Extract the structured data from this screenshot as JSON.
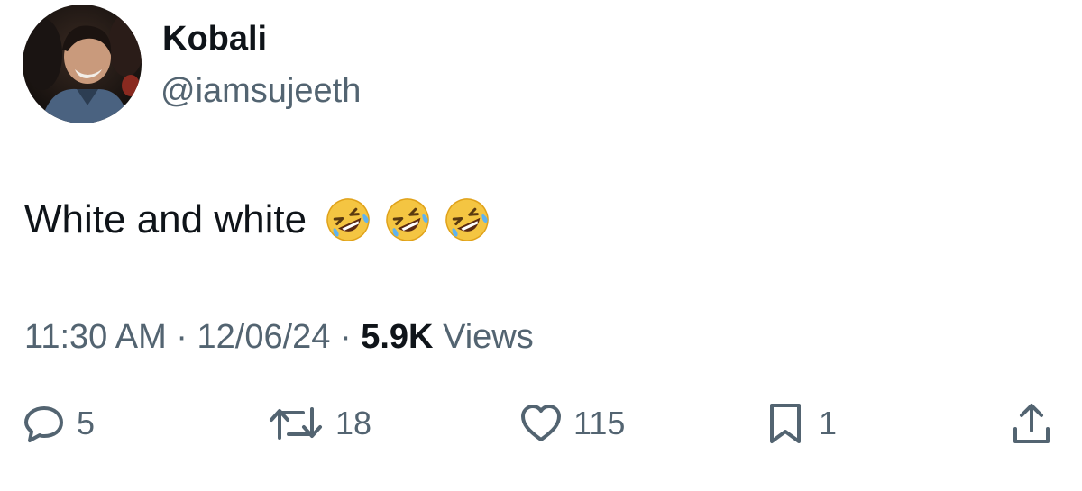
{
  "author": {
    "display_name": "Kobali",
    "handle": "@iamsujeeth"
  },
  "tweet": {
    "text": "White and white",
    "emojis": [
      "rolling-on-the-floor-laughing",
      "rolling-on-the-floor-laughing",
      "rolling-on-the-floor-laughing"
    ]
  },
  "meta": {
    "time": "11:30 AM",
    "separator": "·",
    "date": "12/06/24",
    "views_count": "5.9K",
    "views_label": "Views"
  },
  "actions": {
    "replies": "5",
    "reposts": "18",
    "likes": "115",
    "bookmarks": "1"
  },
  "icons": {
    "reply": "reply-bubble-icon",
    "repost": "repost-arrows-icon",
    "like": "heart-icon",
    "bookmark": "bookmark-icon",
    "share": "share-upload-icon"
  },
  "colors": {
    "primary_text": "#0f1419",
    "secondary_text": "#536471",
    "background": "#ffffff"
  }
}
